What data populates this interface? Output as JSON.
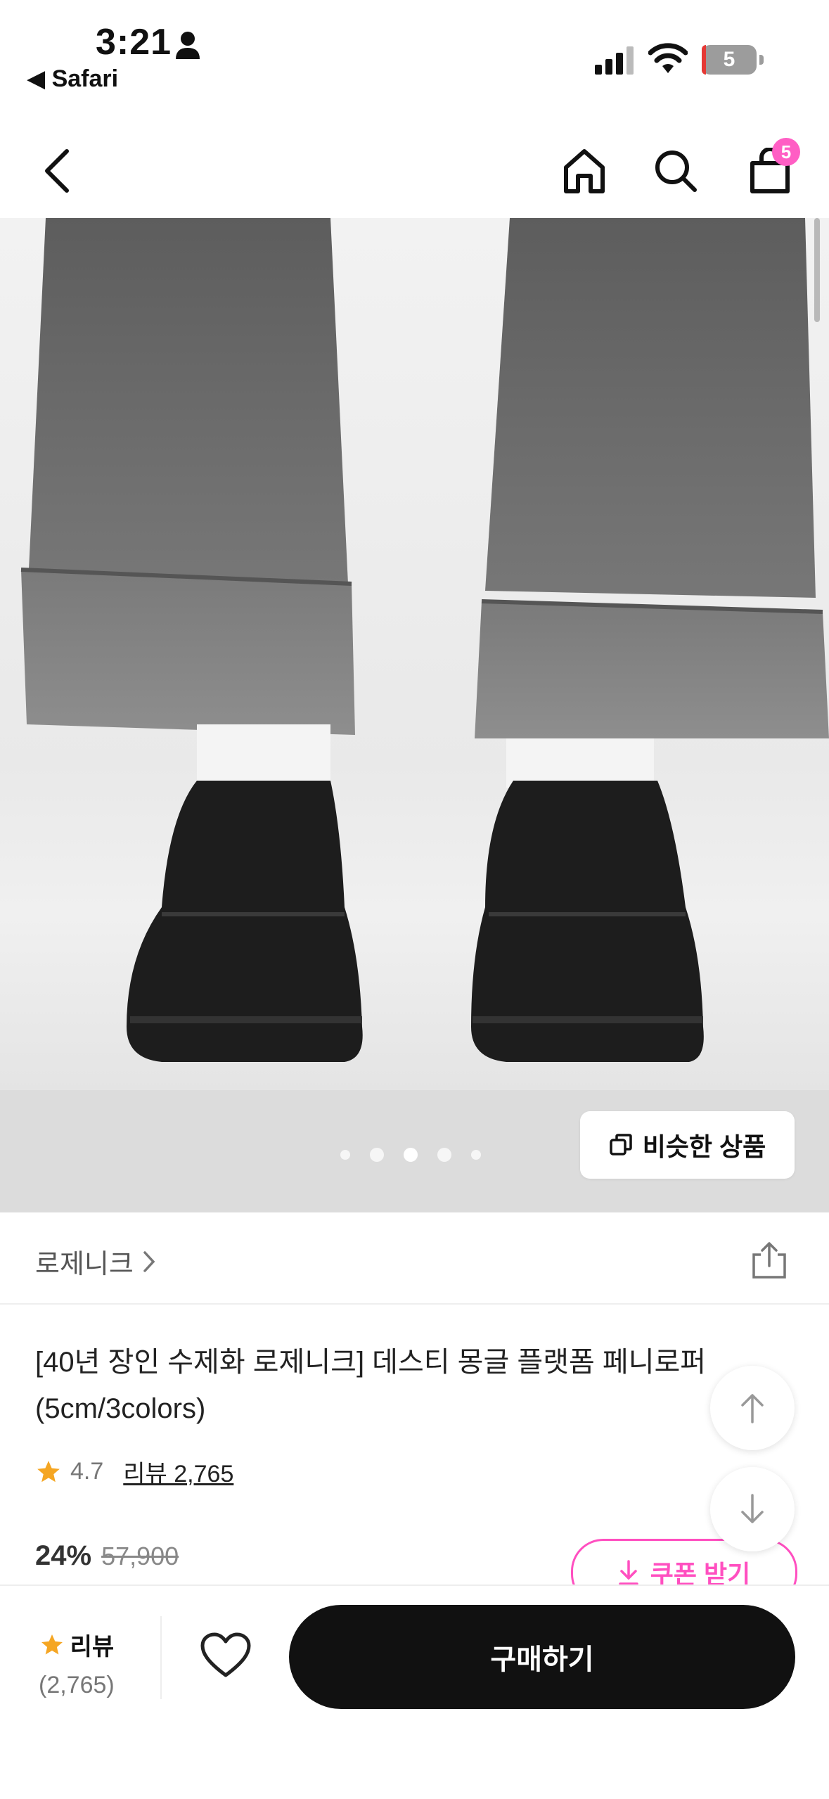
{
  "status_bar": {
    "time": "3:21",
    "back_app": "◀ Safari",
    "battery": "5"
  },
  "nav": {
    "cart_count": "5"
  },
  "gallery": {
    "similar_label": "비슷한 상품",
    "dots_total": 5,
    "active_index": 2
  },
  "product": {
    "brand": "로제니크",
    "title": "[40년 장인 수제화 로제니크] 데스티 몽글 플랫폼 페니로퍼 (5cm/3colors)",
    "rating": "4.7",
    "review_link": "리뷰 2,765",
    "discount": "24%",
    "original_price": "57,900",
    "coupon_label": "쿠폰 받기"
  },
  "bottom_bar": {
    "review_label": "리뷰",
    "review_count": "(2,765)",
    "buy_label": "구매하기"
  },
  "colors": {
    "accent_pink": "#ff4fc0",
    "star": "#f5a623",
    "buy_bg": "#111111"
  },
  "icons": [
    "person-icon",
    "signal-icon",
    "wifi-icon",
    "battery-icon",
    "back-chevron-icon",
    "home-icon",
    "search-icon",
    "cart-icon",
    "copy-icon",
    "chevron-right-icon",
    "share-icon",
    "star-icon",
    "download-icon",
    "arrow-up-icon",
    "arrow-down-icon",
    "heart-icon"
  ]
}
